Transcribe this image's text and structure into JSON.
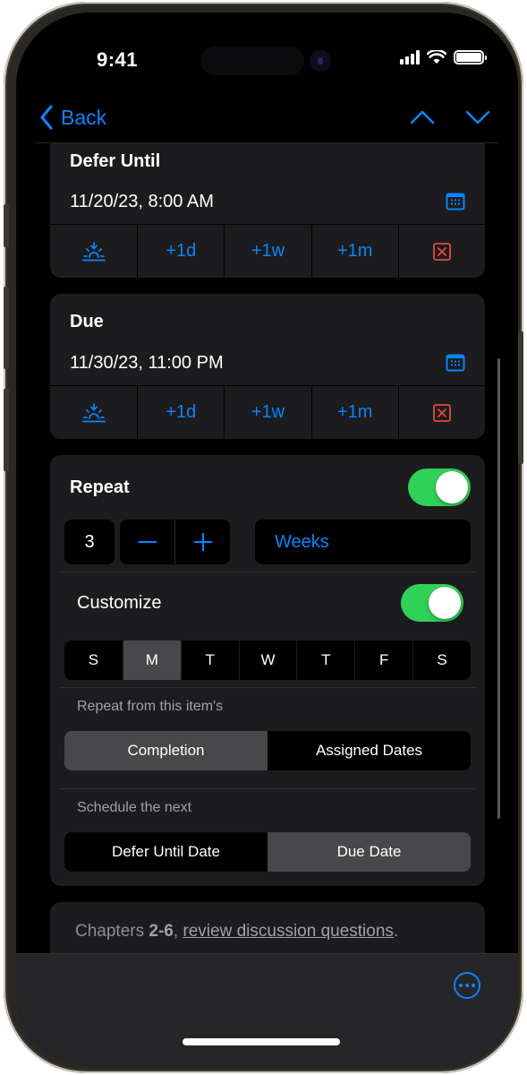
{
  "status_bar": {
    "time": "9:41"
  },
  "nav": {
    "back_label": "Back"
  },
  "defer": {
    "title": "Defer Until",
    "value": "11/20/23, 8:00 AM",
    "quick": [
      "+1d",
      "+1w",
      "+1m"
    ]
  },
  "due": {
    "title": "Due",
    "value": "11/30/23, 11:00 PM",
    "quick": [
      "+1d",
      "+1w",
      "+1m"
    ]
  },
  "repeat": {
    "label": "Repeat",
    "enabled": true,
    "count": "3",
    "minus": "−",
    "plus": "+",
    "unit": "Weeks",
    "customize_label": "Customize",
    "customize_enabled": true,
    "days": [
      {
        "label": "S",
        "selected": false
      },
      {
        "label": "M",
        "selected": true
      },
      {
        "label": "T",
        "selected": false
      },
      {
        "label": "W",
        "selected": false
      },
      {
        "label": "T",
        "selected": false
      },
      {
        "label": "F",
        "selected": false
      },
      {
        "label": "S",
        "selected": false
      }
    ],
    "repeat_from_label": "Repeat from this item's",
    "repeat_from_options": [
      "Completion",
      "Assigned Dates"
    ],
    "repeat_from_selected": "Completion",
    "schedule_label": "Schedule the next",
    "schedule_options": [
      "Defer Until Date",
      "Due Date"
    ],
    "schedule_selected": "Due Date"
  },
  "note": {
    "prefix": "Chapters ",
    "bold": "2-6",
    "sep": ", ",
    "link": "review discussion questions",
    "suffix": "."
  },
  "colors": {
    "accent": "#0a84ff",
    "toggle_on": "#30d158",
    "destructive": "#e5483d",
    "card": "#1c1c1e",
    "selected_segment": "#48484a"
  },
  "icons": {
    "back": "chevron-left-icon",
    "prev": "chevron-up-icon",
    "next": "chevron-down-icon",
    "calendar": "calendar-icon",
    "sunrise": "sunrise-icon",
    "clear": "clear-x-icon",
    "more": "ellipsis-circle-icon"
  }
}
